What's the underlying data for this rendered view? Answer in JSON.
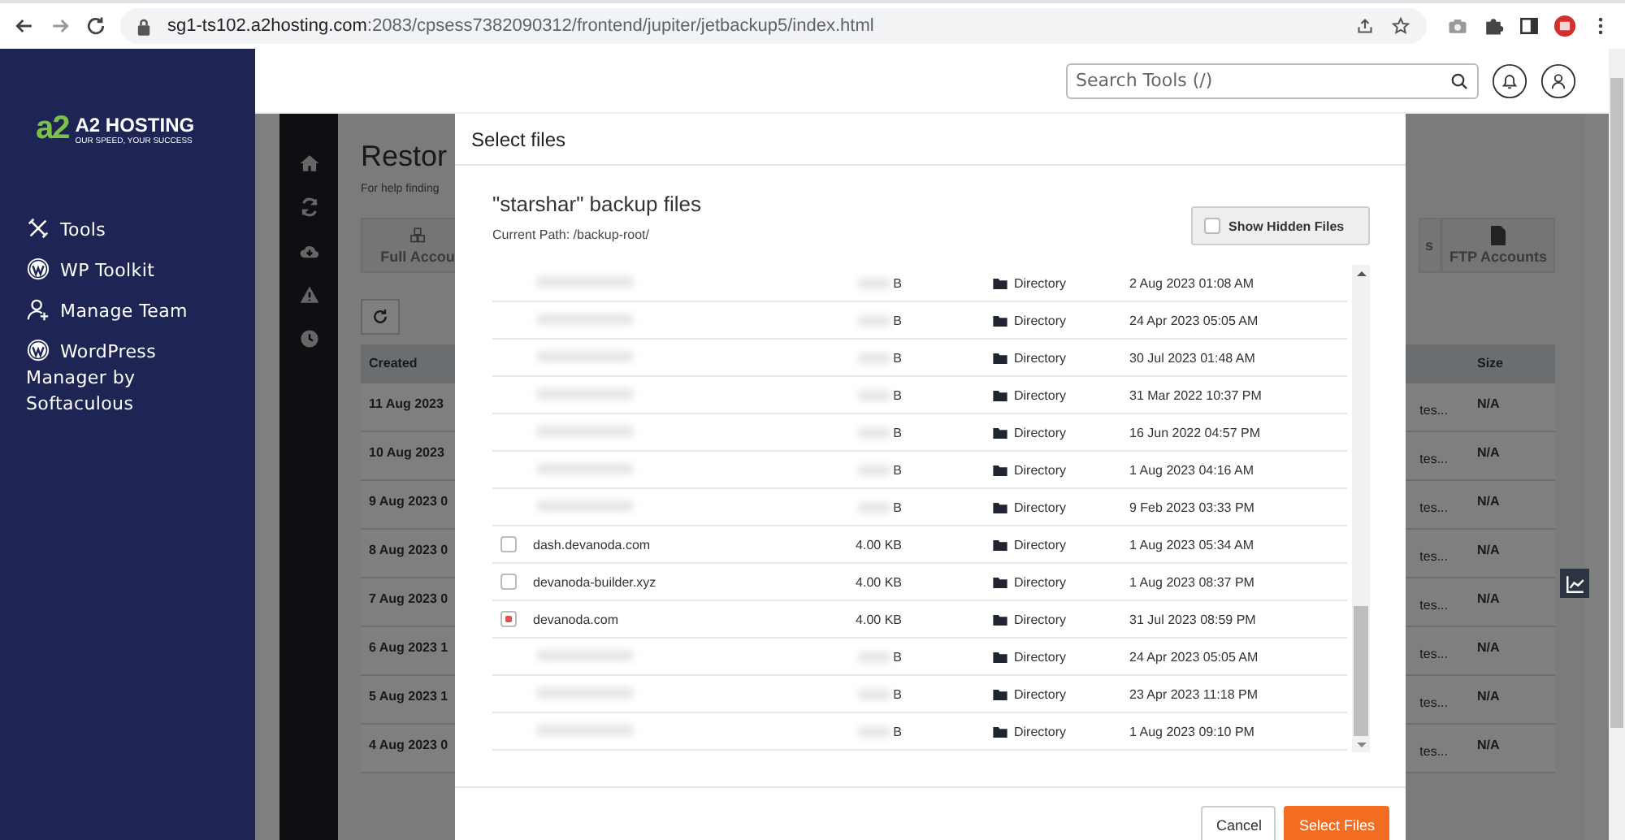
{
  "browser": {
    "url_host": "sg1-ts102.a2hosting.com",
    "url_rest": ":2083/cpsess7382090312/frontend/jupiter/jetbackup5/index.html"
  },
  "sidebar": {
    "logo_mark": "a2",
    "logo_name": "A2 HOSTING",
    "logo_tagline": "OUR SPEED, YOUR SUCCESS",
    "items": [
      {
        "kind": "tools",
        "label": "Tools"
      },
      {
        "kind": "wordpress",
        "label": "WP Toolkit"
      },
      {
        "kind": "team",
        "label": "Manage Team"
      },
      {
        "kind": "wordpress",
        "label": "WordPress Manager by Softaculous"
      }
    ]
  },
  "header": {
    "search_placeholder": "Search Tools (/)"
  },
  "background_page": {
    "title": "Restor",
    "help": "For help finding",
    "tiles": [
      {
        "kind": "cubes",
        "label": "Full Accou"
      },
      {
        "kind": "file",
        "label": "FTP Accounts"
      }
    ],
    "tile_fragment": "s",
    "columns": [
      "Created",
      "Size"
    ],
    "rows": [
      {
        "created": "11 Aug 2023",
        "mid": "tes...",
        "size": "N/A"
      },
      {
        "created": "10 Aug 2023",
        "mid": "tes...",
        "size": "N/A"
      },
      {
        "created": "9 Aug 2023 0",
        "mid": "tes...",
        "size": "N/A"
      },
      {
        "created": "8 Aug 2023 0",
        "mid": "tes...",
        "size": "N/A"
      },
      {
        "created": "7 Aug 2023 0",
        "mid": "tes...",
        "size": "N/A"
      },
      {
        "created": "6 Aug 2023 1",
        "mid": "tes...",
        "size": "N/A"
      },
      {
        "created": "5 Aug 2023 1",
        "mid": "tes...",
        "size": "N/A"
      },
      {
        "created": "4 Aug 2023 0",
        "mid": "tes...",
        "size": "N/A"
      }
    ]
  },
  "modal": {
    "title": "Select files",
    "heading": "\"starshar\" backup files",
    "path": "Current Path: /backup-root/",
    "show_hidden": {
      "label": "Show Hidden Files",
      "checked": false
    },
    "files": [
      {
        "redacted": true,
        "size": "B",
        "type": "Directory",
        "modified": "2 Aug 2023 01:08 AM"
      },
      {
        "redacted": true,
        "size": "B",
        "type": "Directory",
        "modified": "24 Apr 2023 05:05 AM"
      },
      {
        "redacted": true,
        "size": "B",
        "type": "Directory",
        "modified": "30 Jul 2023 01:48 AM"
      },
      {
        "redacted": true,
        "size": "B",
        "type": "Directory",
        "modified": "31 Mar 2022 10:37 PM"
      },
      {
        "redacted": true,
        "size": "B",
        "type": "Directory",
        "modified": "16 Jun 2022 04:57 PM"
      },
      {
        "redacted": true,
        "size": "B",
        "type": "Directory",
        "modified": "1 Aug 2023 04:16 AM"
      },
      {
        "redacted": true,
        "size": "B",
        "type": "Directory",
        "modified": "9 Feb 2023 03:33 PM"
      },
      {
        "redacted": false,
        "name": "dash.devanoda.com",
        "checked": false,
        "size": "4.00 KB",
        "type": "Directory",
        "modified": "1 Aug 2023 05:34 AM"
      },
      {
        "redacted": false,
        "name": "devanoda-builder.xyz",
        "checked": false,
        "size": "4.00 KB",
        "type": "Directory",
        "modified": "1 Aug 2023 08:37 PM"
      },
      {
        "redacted": false,
        "name": "devanoda.com",
        "checked": true,
        "size": "4.00 KB",
        "type": "Directory",
        "modified": "31 Jul 2023 08:59 PM"
      },
      {
        "redacted": true,
        "size": "B",
        "type": "Directory",
        "modified": "24 Apr 2023 05:05 AM"
      },
      {
        "redacted": true,
        "size": "B",
        "type": "Directory",
        "modified": "23 Apr 2023 11:18 PM"
      },
      {
        "redacted": true,
        "size": "B",
        "type": "Directory",
        "modified": "1 Aug 2023 09:10 PM"
      }
    ],
    "buttons": [
      {
        "kind": "secondary",
        "label": "Cancel"
      },
      {
        "kind": "primary",
        "label": "Select Files"
      }
    ]
  }
}
